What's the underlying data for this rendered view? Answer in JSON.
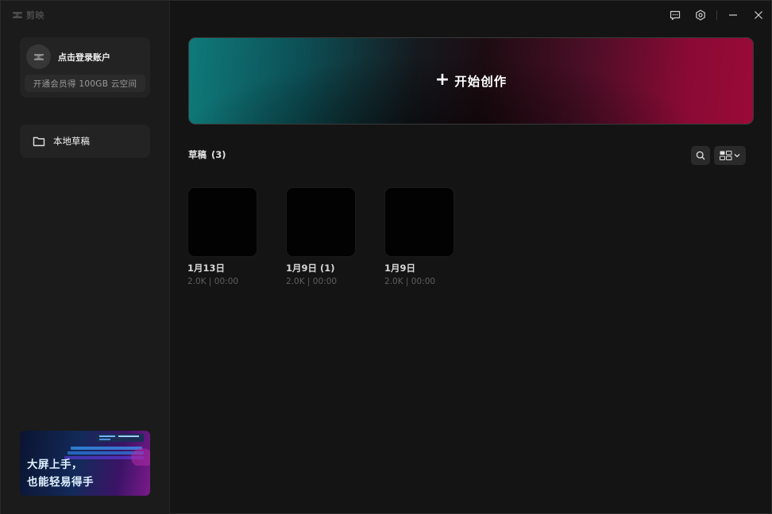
{
  "app": {
    "name": "剪映"
  },
  "account": {
    "login_label": "点击登录账户",
    "vip_offer": "开通会员得 100GB 云空间"
  },
  "nav": {
    "local_drafts": "本地草稿"
  },
  "promo": {
    "line1": "大屏上手，",
    "line2": "也能轻易得手"
  },
  "create": {
    "icon": "+",
    "label": "开始创作"
  },
  "drafts": {
    "title": "草稿",
    "count": "(3)",
    "items": [
      {
        "title": "1月13日",
        "meta": "2.0K | 00:00"
      },
      {
        "title": "1月9日 (1)",
        "meta": "2.0K | 00:00"
      },
      {
        "title": "1月9日",
        "meta": "2.0K | 00:00"
      }
    ]
  },
  "icons": {
    "feedback": "message-alert-icon",
    "settings": "hexagon-gear-icon",
    "minimize": "minimize-icon",
    "close": "close-icon",
    "search": "search-icon",
    "view": "grid-view-icon",
    "folder": "folder-icon"
  },
  "colors": {
    "background": "#141414",
    "sidebar": "#1b1b1b",
    "card": "#232323",
    "teal": "#0f7a7a",
    "crimson": "#9a0a38"
  }
}
